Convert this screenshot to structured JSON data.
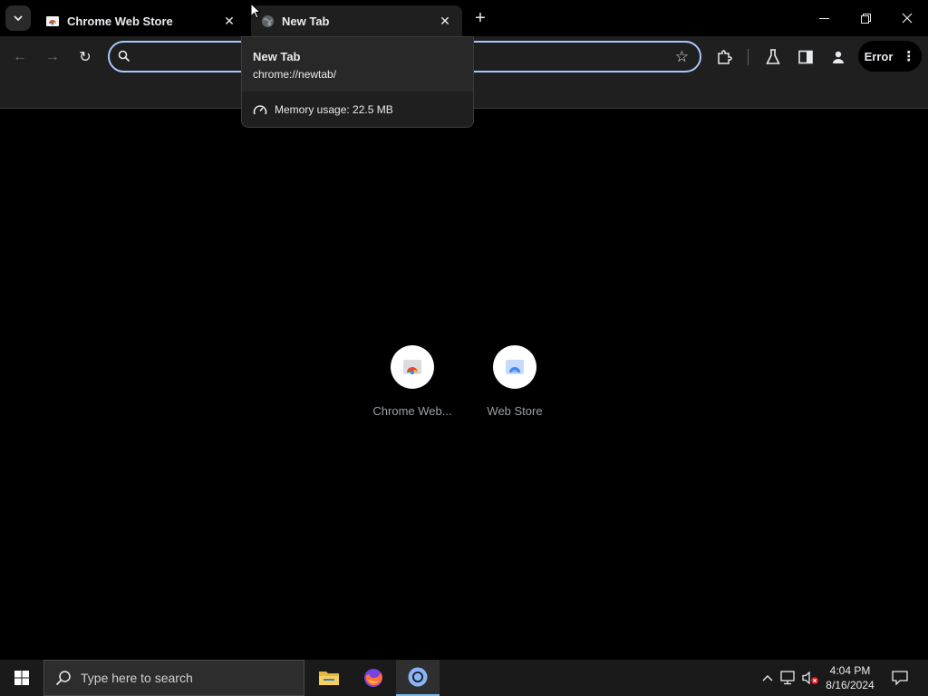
{
  "tabs": [
    {
      "title": "Chrome Web Store",
      "close": "✕"
    },
    {
      "title": "New Tab",
      "close": "✕"
    }
  ],
  "newtab_symbol": "+",
  "window_controls": {
    "minimize": "—",
    "restore": "❐",
    "close": "✕"
  },
  "toolbar": {
    "back_icon": "←",
    "forward_icon": "→",
    "reload_icon": "↻",
    "omnibox_value": "",
    "star_icon": "☆",
    "error_label": "Error",
    "menu_dots": "⋮"
  },
  "hovercard": {
    "title": "New Tab",
    "url": "chrome://newtab/",
    "memory": "Memory usage: 22.5 MB"
  },
  "shortcuts": [
    {
      "label": "Chrome Web..."
    },
    {
      "label": "Web Store"
    }
  ],
  "taskbar": {
    "search_placeholder": "Type here to search",
    "time": "4:04 PM",
    "date": "8/16/2024",
    "tray_chevron": "^"
  },
  "colors": {
    "accent": "#a8c7fa",
    "toolbar_bg": "#1f1f1f",
    "page_bg": "#000000",
    "taskbar_active": "#76b9ed"
  }
}
